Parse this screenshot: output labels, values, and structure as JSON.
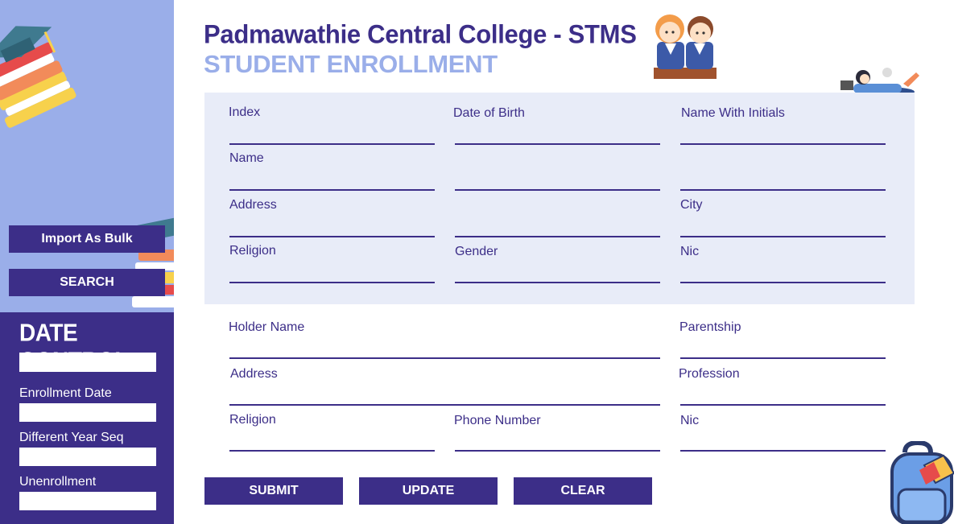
{
  "header": {
    "title": "Padmawathie Central College - STMS",
    "subtitle": "STUDENT ENROLLMENT"
  },
  "sidebar": {
    "import_label": "Import As Bulk",
    "search_label": "SEARCH",
    "date_control": {
      "title": "DATE CONTROL",
      "enrollment_date_label": "Enrollment Date",
      "different_year_seq_label": "Different Year Seq",
      "unenrollment_label": "Unenrollment"
    }
  },
  "student": {
    "index_label": "Index",
    "dob_label": "Date of Birth",
    "name_initials_label": "Name With Initials",
    "name_label": "Name",
    "address_label": "Address",
    "city_label": "City",
    "religion_label": "Religion",
    "gender_label": "Gender",
    "nic_label": "Nic"
  },
  "guardian": {
    "holder_name_label": "Holder Name",
    "parentship_label": "Parentship",
    "address_label": "Address",
    "profession_label": "Profession",
    "religion_label": "Religion",
    "phone_label": "Phone Number",
    "nic_label": "Nic"
  },
  "actions": {
    "submit_label": "SUBMIT",
    "update_label": "UPDATE",
    "clear_label": "CLEAR"
  },
  "colors": {
    "primary": "#3c2e88",
    "sidebar_bg": "#9aaee9",
    "panel_bg": "#e8ecf8"
  }
}
